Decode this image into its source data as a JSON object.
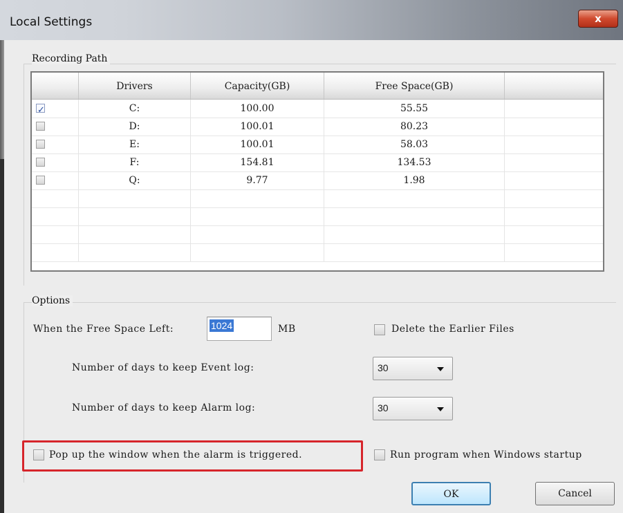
{
  "window": {
    "title": "Local Settings",
    "close_label": "x"
  },
  "recording_path": {
    "label": "Recording Path",
    "columns": [
      "Drivers",
      "Capacity(GB)",
      "Free Space(GB)"
    ],
    "rows": [
      {
        "checked": true,
        "driver": "C:",
        "capacity": "100.00",
        "free": "55.55"
      },
      {
        "checked": false,
        "driver": "D:",
        "capacity": "100.01",
        "free": "80.23"
      },
      {
        "checked": false,
        "driver": "E:",
        "capacity": "100.01",
        "free": "58.03"
      },
      {
        "checked": false,
        "driver": "F:",
        "capacity": "154.81",
        "free": "134.53"
      },
      {
        "checked": false,
        "driver": "Q:",
        "capacity": "9.77",
        "free": "1.98"
      }
    ]
  },
  "options": {
    "label": "Options",
    "free_space_label": "When the Free Space Left:",
    "free_space_value": "1024",
    "free_space_unit": "MB",
    "delete_earlier_label": "Delete the Earlier Files",
    "event_log_label": "Number of days to keep Event log:",
    "event_log_value": "30",
    "alarm_log_label": "Number of days to keep Alarm log:",
    "alarm_log_value": "30",
    "popup_label": "Pop up the window when the alarm is triggered.",
    "run_startup_label": "Run program when Windows startup"
  },
  "buttons": {
    "ok": "OK",
    "cancel": "Cancel"
  },
  "colors": {
    "highlight_border": "#d6252b",
    "selection": "#3a78d4",
    "close_button": "#c8442a"
  }
}
